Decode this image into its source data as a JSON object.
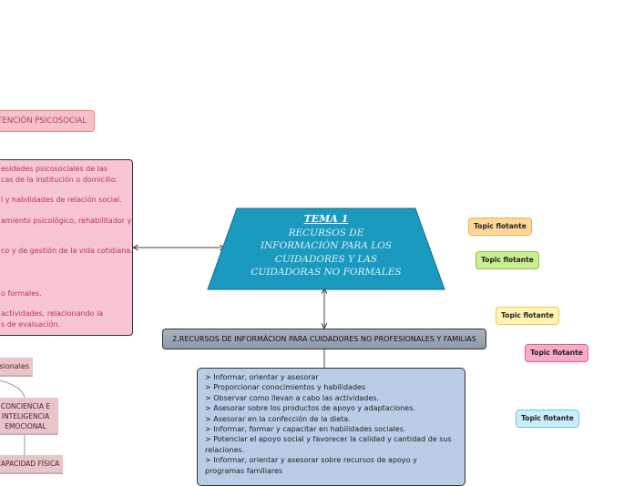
{
  "psicosocial": {
    "title": "ATENCIÓN PSICOSOCIAL",
    "lines": [
      "esidades psicosociales de las",
      "cas de la institución o domicilio.",
      "l y habilidades de relación social.",
      "amiento psicológico, rehabilitador y",
      "co y de gestión de la vida cotidiana.",
      "o formales.",
      "actividades, relacionando la",
      "s de evaluación."
    ]
  },
  "central": {
    "title": "TEMA 1",
    "lines": [
      "RECURSOS DE",
      "INFORMACIÓN PARA LOS",
      "CUIDADORES Y LAS",
      "CUIDADORAS NO FORMALES"
    ],
    "color": "#1a9abf"
  },
  "recursos": {
    "title": "2.RECURSOS DE INFORMÁCION PARA CUIDADORES NO PROFESIONALES Y FAMILIAS",
    "items": [
      "> Informar, orientar y asesorar",
      "> Proporcionar conocimientos y habilidades",
      "> Observar como llevan a cabo las actividades.",
      "> Asesorar sobre los productos de apoyo y adaptaciones.",
      "> Asesorar en la confección de la dieta.",
      "> Informar, formar y capacitar en habilidades sociales.",
      "> Potenciar el apoyo social y favorecer la calidad y cantidad de sus relaciones.",
      "> Informar, orientar y asesorar sobre recursos de apoyo y programas familiares"
    ]
  },
  "floating": [
    {
      "label": "Topic flotante",
      "bg": "#fdd89a",
      "border": "#eeb050"
    },
    {
      "label": "Topic flotante",
      "bg": "#c9ef92",
      "border": "#8fc040"
    },
    {
      "label": "Topic flotante",
      "bg": "#fff5b0",
      "border": "#e3cc5a"
    },
    {
      "label": "Topic flotante",
      "bg": "#f8abc9",
      "border": "#df5f90"
    },
    {
      "label": "Topic flotante",
      "bg": "#c9eefa",
      "border": "#6ec6e6"
    }
  ],
  "left_nodes": [
    "sionales",
    "CONCIENCIA E INTELIGENCIA EMOCIONAL",
    "CAPACIDAD FÍSICA"
  ]
}
